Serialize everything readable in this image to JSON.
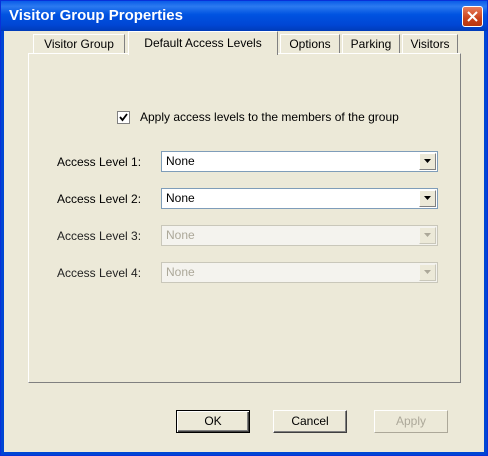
{
  "window": {
    "title": "Visitor Group Properties"
  },
  "tabs": [
    {
      "label": "Visitor Group",
      "active": false
    },
    {
      "label": "Default Access Levels",
      "active": true
    },
    {
      "label": "Options",
      "active": false
    },
    {
      "label": "Parking",
      "active": false
    },
    {
      "label": "Visitors",
      "active": false
    }
  ],
  "apply_checkbox": {
    "label": "Apply access levels to the members of the group",
    "checked": true
  },
  "access_levels": [
    {
      "label": "Access Level 1:",
      "value": "None",
      "enabled": true
    },
    {
      "label": "Access Level 2:",
      "value": "None",
      "enabled": true
    },
    {
      "label": "Access Level 3:",
      "value": "None",
      "enabled": false
    },
    {
      "label": "Access Level 4:",
      "value": "None",
      "enabled": false
    }
  ],
  "buttons": {
    "ok": "OK",
    "cancel": "Cancel",
    "apply": "Apply"
  },
  "colors": {
    "title_bar": "#0053e1",
    "face": "#ece9d8",
    "close": "#c9421b"
  }
}
